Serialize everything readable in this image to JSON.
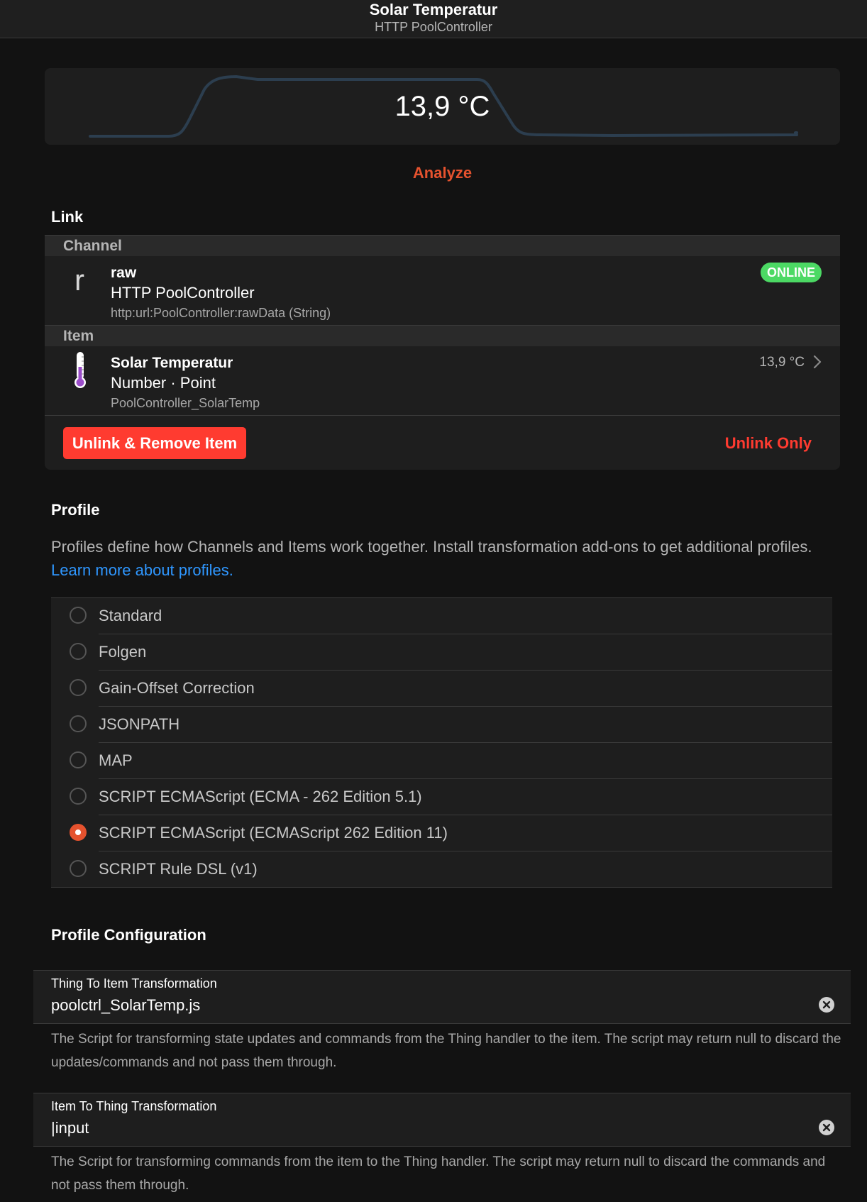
{
  "navbar": {
    "title": "Solar Temperatur",
    "subtitle": "HTTP PoolController"
  },
  "state": {
    "value": "13,9 °C",
    "analyze_label": "Analyze"
  },
  "link": {
    "section_title": "Link",
    "channel": {
      "header": "Channel",
      "icon_letter": "r",
      "title": "raw",
      "subtitle": "HTTP PoolController",
      "footer": "http:url:PoolController:rawData (String)",
      "status": "ONLINE"
    },
    "item": {
      "header": "Item",
      "icon": "thermometer-icon",
      "title": "Solar Temperatur",
      "subtitle": "Number · Point",
      "footer": "PoolController_SolarTemp",
      "state": "13,9 °C"
    },
    "unlink_remove_label": "Unlink & Remove Item",
    "unlink_only_label": "Unlink Only"
  },
  "profile": {
    "section_title": "Profile",
    "description": "Profiles define how Channels and Items work together. Install transformation add-ons to get additional profiles.",
    "learn_more": "Learn more about profiles.",
    "options": [
      {
        "label": "Standard",
        "selected": false
      },
      {
        "label": "Folgen",
        "selected": false
      },
      {
        "label": "Gain-Offset Correction",
        "selected": false
      },
      {
        "label": "JSONPATH",
        "selected": false
      },
      {
        "label": "MAP",
        "selected": false
      },
      {
        "label": "SCRIPT ECMAScript (ECMA - 262 Edition 5.1)",
        "selected": false
      },
      {
        "label": "SCRIPT ECMAScript (ECMAScript 262 Edition 11)",
        "selected": true
      },
      {
        "label": "SCRIPT Rule DSL (v1)",
        "selected": false
      }
    ]
  },
  "profile_config": {
    "section_title": "Profile Configuration",
    "thing_to_item": {
      "label": "Thing To Item Transformation",
      "value": "poolctrl_SolarTemp.js",
      "info": "The Script for transforming state updates and commands from the Thing handler to the item. The script may return null to discard the updates/commands and not pass them through."
    },
    "item_to_thing": {
      "label": "Item To Thing Transformation",
      "value": "|input",
      "info": "The Script for transforming commands from the item to the Thing handler. The script may return null to discard the commands and not pass them through."
    }
  },
  "colors": {
    "accent": "#e5522e",
    "danger": "#ff3b30",
    "online": "#4cd964",
    "link": "#2f97ff"
  }
}
